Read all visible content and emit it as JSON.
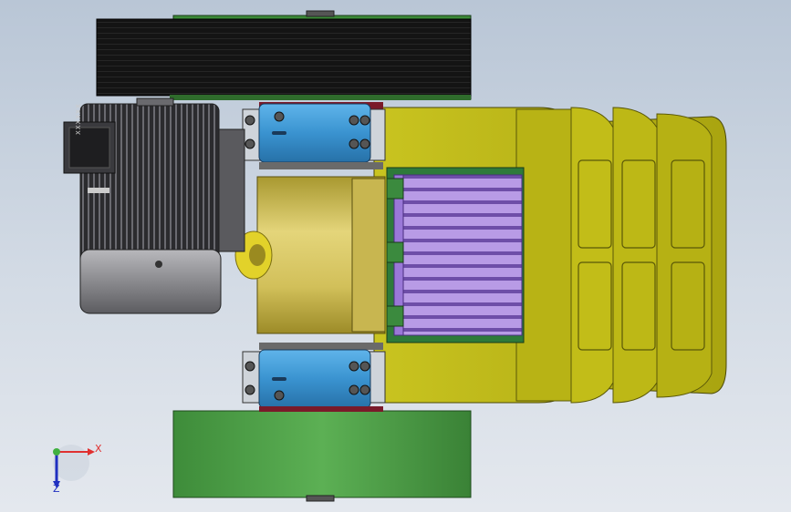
{
  "viewport": {
    "axes": {
      "x_label": "X",
      "z_label": "Z"
    },
    "colors": {
      "pulley_dark": "#1a1a1a",
      "pulley_green": "#4fa04a",
      "motor_grey": "#8a8a8e",
      "bearing_blue": "#3f9bd6",
      "housing_yellow": "#c7c21a",
      "drum_yellow": "#d4c254",
      "rotor_purple": "#a98bd9"
    },
    "motor_nameplate": "XXXXXX"
  }
}
